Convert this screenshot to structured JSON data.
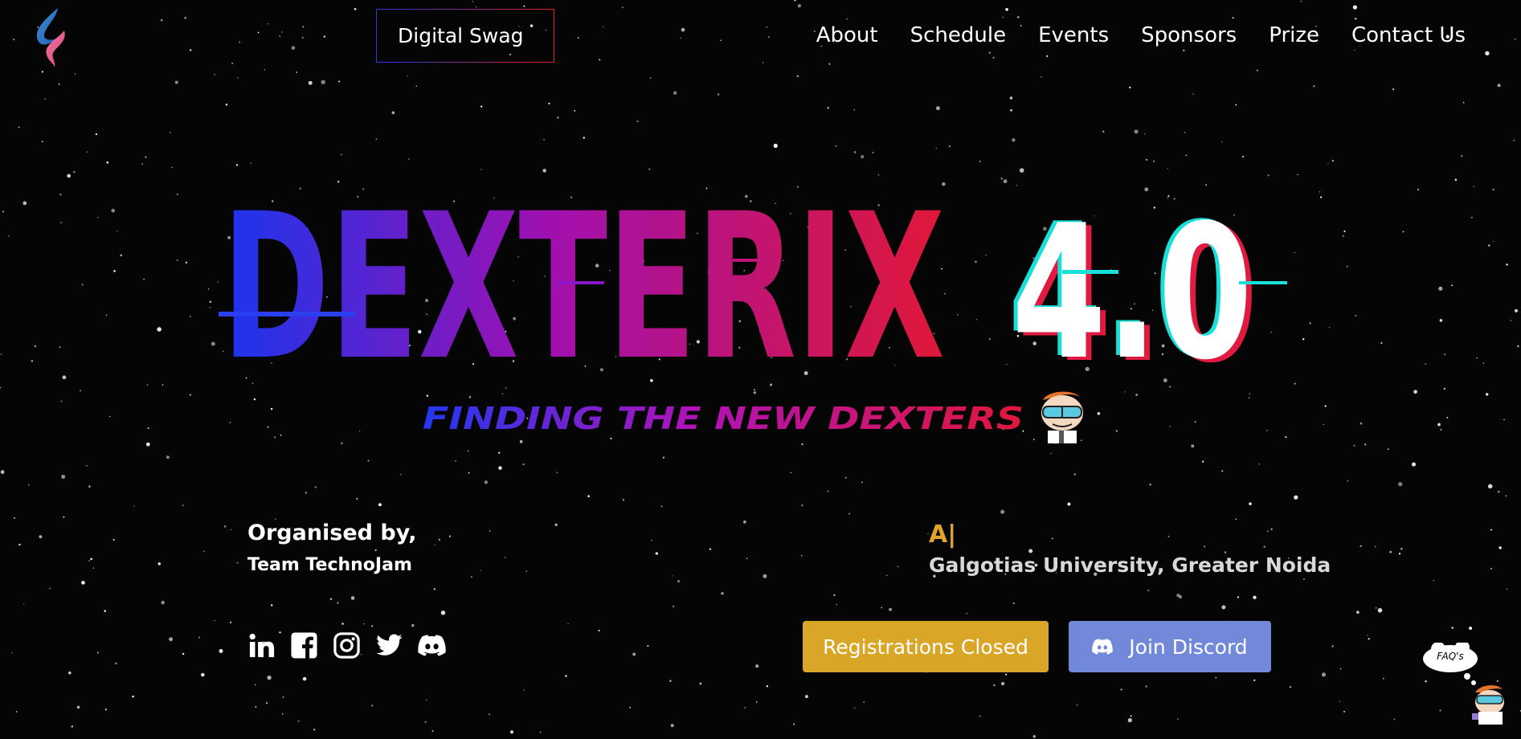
{
  "header": {
    "logo_icon": "technojam-flame-logo-icon",
    "swag_button": "Digital Swag",
    "nav": [
      "About",
      "Schedule",
      "Events",
      "Sponsors",
      "Prize",
      "Contact Us"
    ]
  },
  "hero": {
    "title_main": "DEXTERIX",
    "title_version": "4.0",
    "tagline": "FINDING THE NEW DEXTERS",
    "mascot_icon": "dexter-face-icon"
  },
  "organiser": {
    "label": "Organised by,",
    "name": "Team TechnoJam"
  },
  "venue": {
    "prefix": "A|",
    "name": "Galgotias University, Greater Noida"
  },
  "socials": [
    "linkedin-icon",
    "facebook-icon",
    "instagram-icon",
    "twitter-icon",
    "discord-icon"
  ],
  "actions": {
    "registrations": "Registrations Closed",
    "discord": "Join Discord"
  },
  "faq": {
    "label": "FAQ's"
  },
  "colors": {
    "background": "#050505",
    "gradient_start": "#1a35ee",
    "gradient_mid": "#a010b0",
    "gradient_end": "#e01838",
    "registrations_button": "#daa628",
    "discord_button": "#7289da",
    "venue_accent": "#e0a528"
  }
}
